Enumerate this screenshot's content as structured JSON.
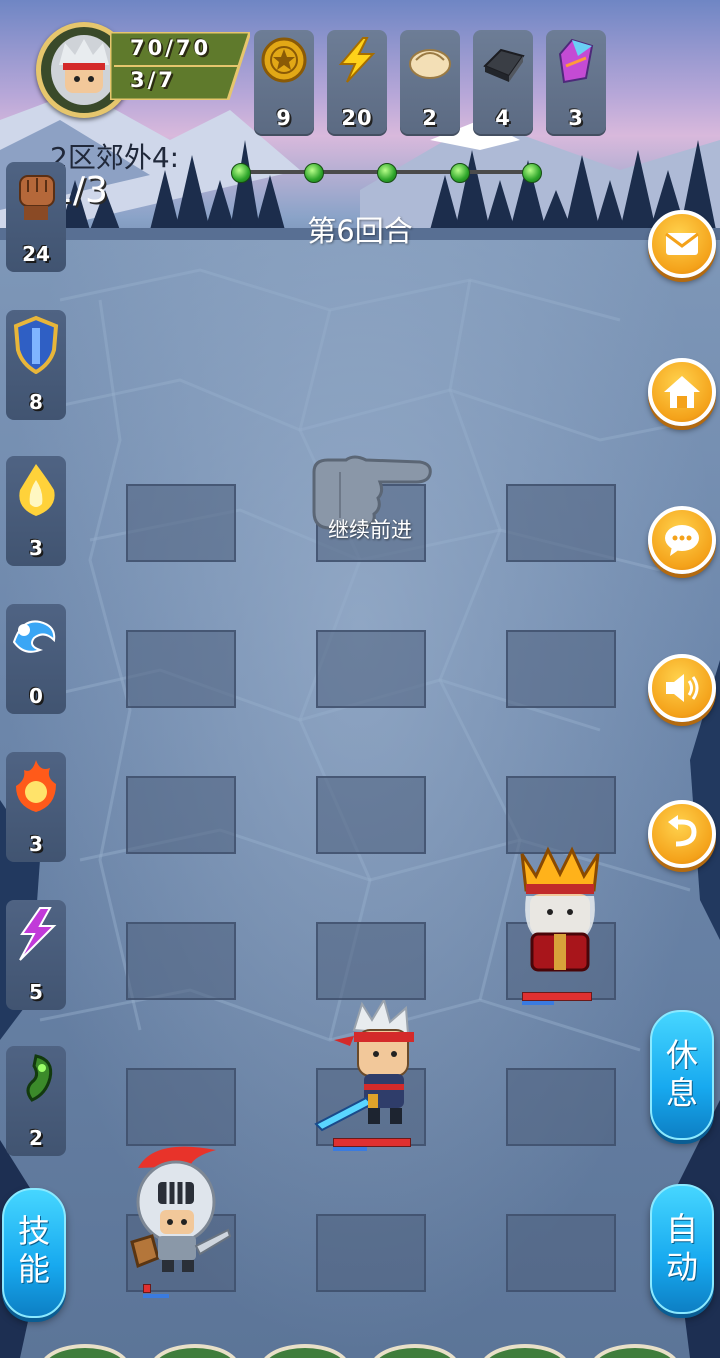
{
  "header": {
    "hp": "70/70",
    "moves": "3/7",
    "resources": [
      {
        "name": "coin",
        "icon": "gold-coin-icon",
        "count": "9"
      },
      {
        "name": "energy",
        "icon": "lightning-icon",
        "count": "20"
      },
      {
        "name": "dumpling",
        "icon": "dumpling-icon",
        "count": "2"
      },
      {
        "name": "iron",
        "icon": "iron-ingot-icon",
        "count": "4"
      },
      {
        "name": "crystal",
        "icon": "crystal-icon",
        "count": "3"
      }
    ]
  },
  "stage": {
    "label": "2区郊外4:",
    "count": "1/3",
    "round": "第6回合",
    "progress_nodes": 5
  },
  "elements": [
    {
      "icon": "fist-icon",
      "count": "24"
    },
    {
      "icon": "shield-icon",
      "count": "8"
    },
    {
      "icon": "holy-flame-icon",
      "count": "3"
    },
    {
      "icon": "water-wave-icon",
      "count": "0"
    },
    {
      "icon": "fire-icon",
      "count": "3"
    },
    {
      "icon": "lightning-purple-icon",
      "count": "5"
    },
    {
      "icon": "poison-icon",
      "count": "2"
    }
  ],
  "side_buttons": [
    "mail-icon",
    "home-icon",
    "chat-icon",
    "sound-icon",
    "back-icon"
  ],
  "hint": "继续前进",
  "rest_button": "休息",
  "auto_button": "自动",
  "skill_button": "技能",
  "units": {
    "hero": {
      "hp": 1.0
    },
    "king": {
      "hp": 1.0
    },
    "knight": {
      "hp": 0.2
    }
  },
  "colors": {
    "accent": "#f4a21a",
    "pill": "#17a9ef",
    "hp": "#e03030",
    "mp": "#3a7be0"
  }
}
